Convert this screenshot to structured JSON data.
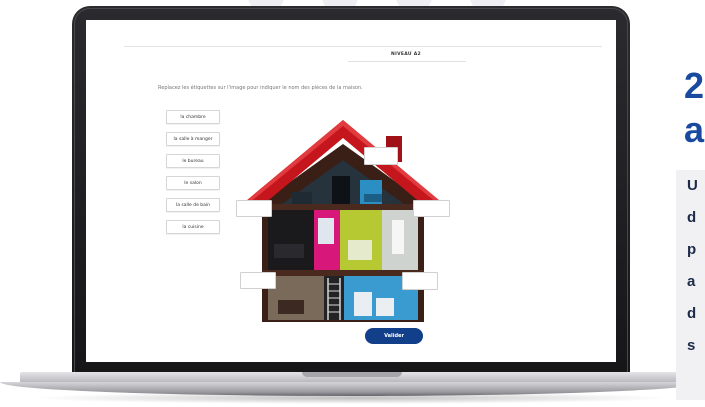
{
  "exercise": {
    "level_title": "NIVEAU A2",
    "instruction": "Replacez les étiquettes sur l'image pour indiquer le nom des pièces de la maison.",
    "labels": [
      "la chambre",
      "la salle à manger",
      "le bureau",
      "le salon",
      "la salle de bain",
      "la cuisine"
    ],
    "validate_label": "Valider"
  },
  "promo": {
    "title_lines": [
      "2",
      "a"
    ],
    "body_lines": [
      "U",
      "d",
      "p",
      "a",
      "d",
      "s"
    ]
  },
  "colors": {
    "accent_blue": "#123f8a",
    "promo_blue": "#1a49a0",
    "roof_red": "#c5161d"
  }
}
